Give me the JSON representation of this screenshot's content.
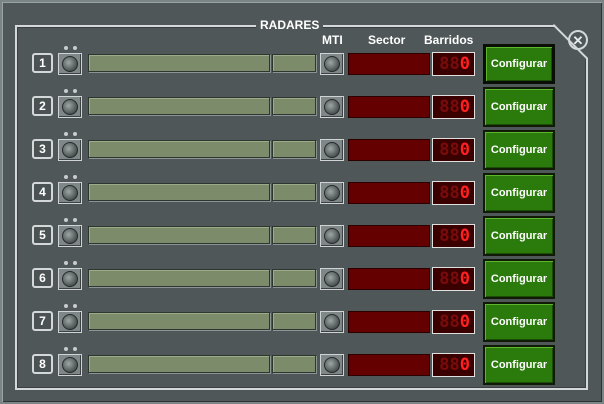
{
  "panel": {
    "title": "RADARES",
    "columns": {
      "mti": "MTI",
      "sector": "Sector",
      "sweeps": "Barridos"
    },
    "close_icon": "close-circle-icon"
  },
  "rows": [
    {
      "number": "1",
      "sweeps_ghost": "88",
      "sweeps_value": "0",
      "button": "Configurar"
    },
    {
      "number": "2",
      "sweeps_ghost": "88",
      "sweeps_value": "0",
      "button": "Configurar"
    },
    {
      "number": "3",
      "sweeps_ghost": "88",
      "sweeps_value": "0",
      "button": "Configurar"
    },
    {
      "number": "4",
      "sweeps_ghost": "88",
      "sweeps_value": "0",
      "button": "Configurar"
    },
    {
      "number": "5",
      "sweeps_ghost": "88",
      "sweeps_value": "0",
      "button": "Configurar"
    },
    {
      "number": "6",
      "sweeps_ghost": "88",
      "sweeps_value": "0",
      "button": "Configurar"
    },
    {
      "number": "7",
      "sweeps_ghost": "88",
      "sweeps_value": "0",
      "button": "Configurar"
    },
    {
      "number": "8",
      "sweeps_ghost": "88",
      "sweeps_value": "0",
      "button": "Configurar"
    }
  ],
  "colors": {
    "background": "#4f5758",
    "frame": "#d4d8d8",
    "bar": "#7c8c6a",
    "sector_field": "#640000",
    "led_digit": "#ff2020",
    "configure_button": "#2b7a0c"
  }
}
